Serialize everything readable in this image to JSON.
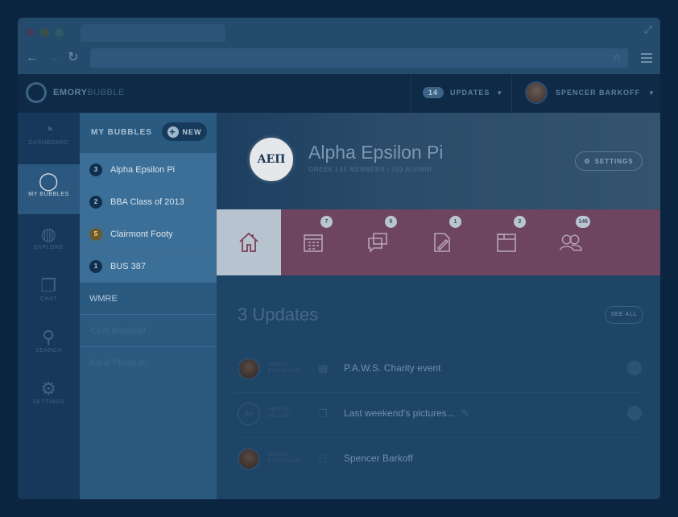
{
  "app": {
    "brand_bold": "EMORY",
    "brand_light": "BUBBLE"
  },
  "browser": {
    "url": ""
  },
  "header": {
    "updates_count": "14",
    "updates_label": "UPDATES",
    "user_name": "SPENCER BARKOFF"
  },
  "rail": {
    "items": [
      {
        "label": "DASHBOARD",
        "icon": "gauge-icon"
      },
      {
        "label": "MY BUBBLES",
        "icon": "bubbles-icon"
      },
      {
        "label": "EXPLORE",
        "icon": "globe-icon"
      },
      {
        "label": "CHAT",
        "icon": "chat-icon"
      },
      {
        "label": "SEARCH",
        "icon": "search-icon"
      },
      {
        "label": "SETTINGS",
        "icon": "gear-icon"
      }
    ]
  },
  "sidebar": {
    "title": "MY BUBBLES",
    "new_label": "NEW",
    "items": [
      {
        "badge": "3",
        "label": "Alpha Epsilon Pi"
      },
      {
        "badge": "2",
        "label": "BBA Class of 2013"
      },
      {
        "badge": "5",
        "label": "Clairmont Footy"
      },
      {
        "badge": "1",
        "label": "BUS 387"
      },
      {
        "badge": "",
        "label": "WMRE"
      },
      {
        "badge": "",
        "label": "Club Baseball"
      },
      {
        "badge": "",
        "label": "Aural Pleasure"
      }
    ]
  },
  "group": {
    "crest": "ΑΕΠ",
    "name": "Alpha Epsilon Pi",
    "meta": "GREEK | 45 MEMBERS | 153 ALUMNI",
    "settings_label": "SETTINGS"
  },
  "tabs": [
    {
      "icon": "home-icon",
      "count": ""
    },
    {
      "icon": "calendar-icon",
      "count": "7"
    },
    {
      "icon": "chat-icon",
      "count": "6"
    },
    {
      "icon": "edit-document-icon",
      "count": "1"
    },
    {
      "icon": "folder-icon",
      "count": "2"
    },
    {
      "icon": "members-icon",
      "count": "146"
    }
  ],
  "updates": {
    "title": "3 Updates",
    "see_all": "SEE ALL",
    "items": [
      {
        "kind_1": "JOINED",
        "kind_2": "5 DAYS AGO",
        "text": "P.A.W.S. Charity event"
      },
      {
        "kind_1": "REPLIED",
        "kind_2": "ON 1/15",
        "text": "Last weekend's pictures..."
      },
      {
        "kind_1": "JOINED",
        "kind_2": "5 DAYS AGO",
        "text": "Spencer Barkoff"
      }
    ]
  }
}
